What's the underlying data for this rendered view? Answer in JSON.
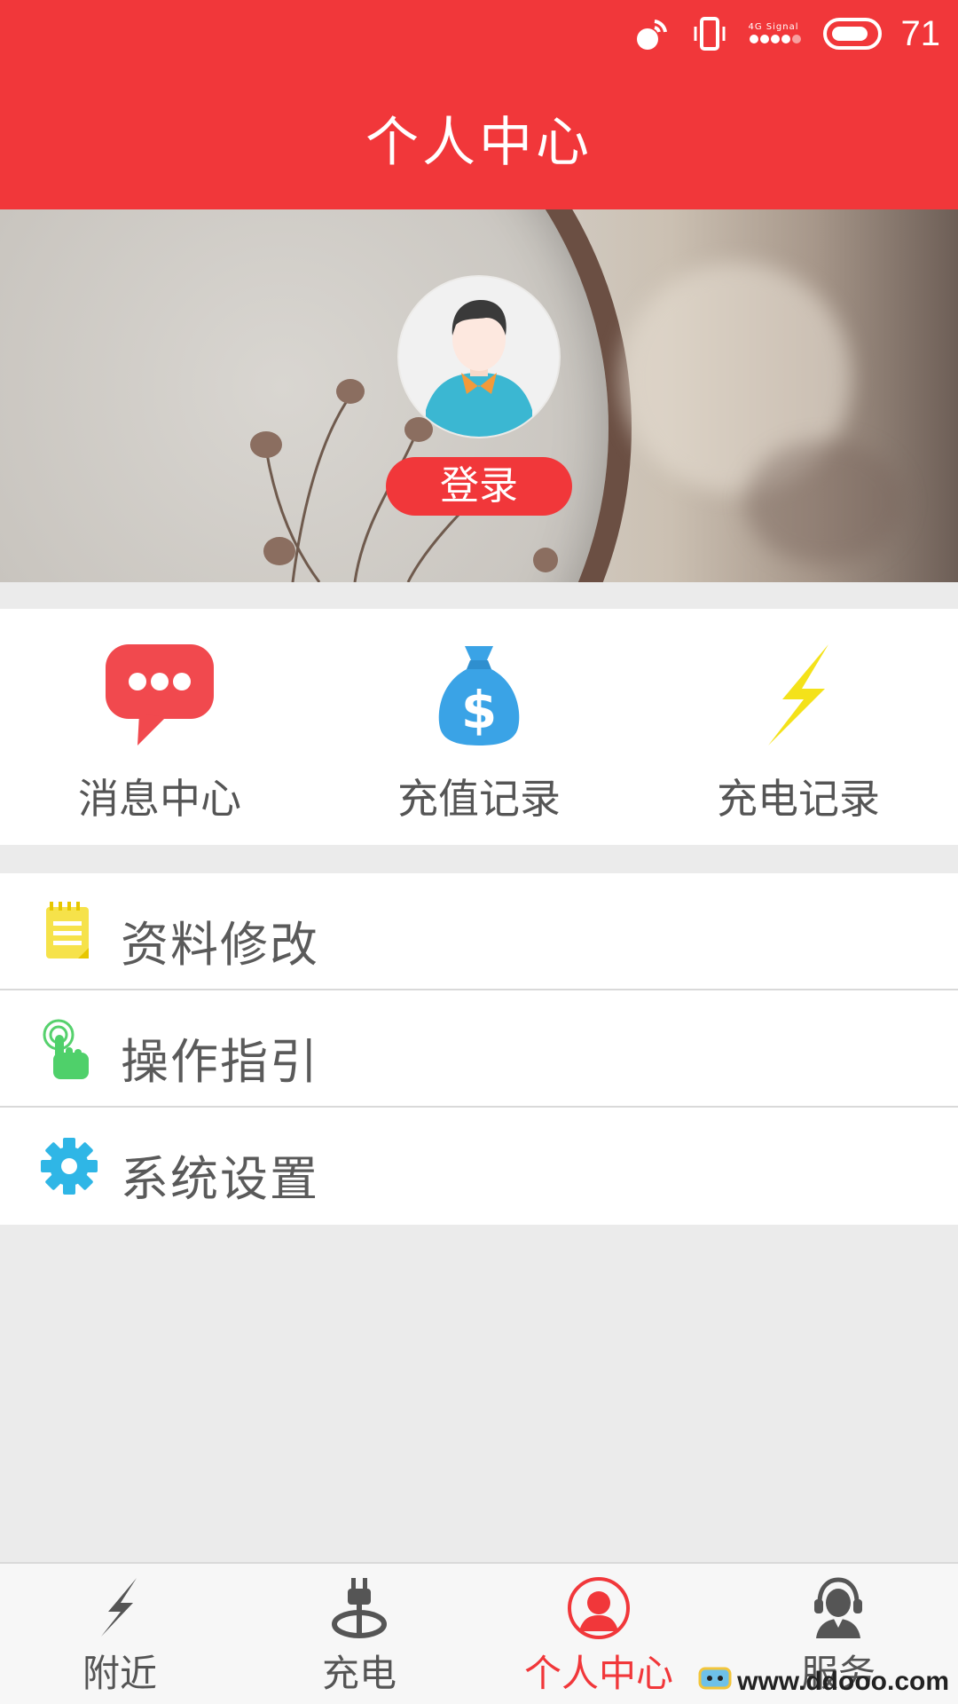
{
  "status_bar": {
    "signal_text": "4G Signal",
    "battery_level": "71",
    "icons": [
      "wifi-signal-icon",
      "vibrate-icon",
      "cell-signal-icon",
      "battery-icon"
    ]
  },
  "header": {
    "title": "个人中心"
  },
  "profile": {
    "login_label": "登录"
  },
  "quick_actions": [
    {
      "label": "消息中心",
      "icon": "chat-bubble-icon"
    },
    {
      "label": "充值记录",
      "icon": "money-bag-icon"
    },
    {
      "label": "充电记录",
      "icon": "lightning-icon"
    }
  ],
  "menu": [
    {
      "label": "资料修改",
      "icon": "notepad-icon"
    },
    {
      "label": "操作指引",
      "icon": "touch-hand-icon"
    },
    {
      "label": "系统设置",
      "icon": "gear-icon"
    }
  ],
  "tabs": [
    {
      "label": "附近",
      "icon": "lightning-icon",
      "active": false
    },
    {
      "label": "充电",
      "icon": "plug-icon",
      "active": false
    },
    {
      "label": "个人中心",
      "icon": "person-icon",
      "active": true
    },
    {
      "label": "服务",
      "icon": "headset-agent-icon",
      "active": false
    }
  ],
  "watermark": {
    "text": "www.ddooo.com"
  },
  "colors": {
    "primary": "#f1373a",
    "text": "#555555",
    "background": "#ebebeb"
  }
}
